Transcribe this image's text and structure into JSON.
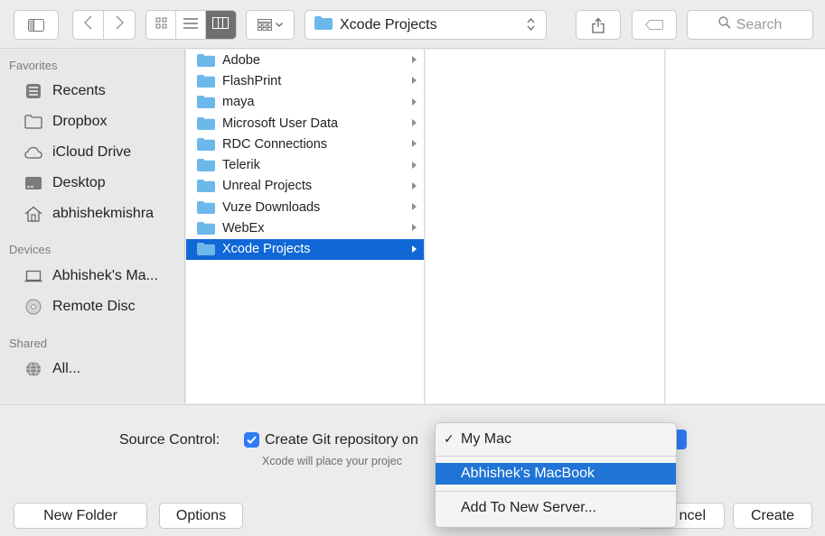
{
  "toolbar": {
    "location": "Xcode Projects",
    "search_placeholder": "Search"
  },
  "sidebar": {
    "favorites_header": "Favorites",
    "favorites": [
      {
        "label": "Recents",
        "icon": "recents-icon"
      },
      {
        "label": "Dropbox",
        "icon": "folder-icon"
      },
      {
        "label": "iCloud Drive",
        "icon": "cloud-icon"
      },
      {
        "label": "Desktop",
        "icon": "desktop-icon"
      },
      {
        "label": "abhishekmishra",
        "icon": "home-icon"
      }
    ],
    "devices_header": "Devices",
    "devices": [
      {
        "label": "Abhishek's Ma...",
        "icon": "laptop-icon"
      },
      {
        "label": "Remote Disc",
        "icon": "disc-icon"
      }
    ],
    "shared_header": "Shared",
    "shared": [
      {
        "label": "All...",
        "icon": "network-globe-icon"
      }
    ]
  },
  "folders": [
    {
      "label": "Adobe"
    },
    {
      "label": "FlashPrint"
    },
    {
      "label": "maya"
    },
    {
      "label": "Microsoft User Data"
    },
    {
      "label": "RDC Connections"
    },
    {
      "label": "Telerik"
    },
    {
      "label": "Unreal Projects"
    },
    {
      "label": "Vuze Downloads"
    },
    {
      "label": "WebEx"
    },
    {
      "label": "Xcode Projects",
      "selected": true
    }
  ],
  "source_control": {
    "label": "Source Control:",
    "checkbox_label": "Create Git repository on",
    "checked": true,
    "hint": "Xcode will place your projec"
  },
  "menu": {
    "items": [
      {
        "label": "My Mac",
        "checked": true
      },
      {
        "label": "Abhishek's MacBook",
        "highlighted": true
      },
      {
        "label": "Add To New Server..."
      }
    ]
  },
  "buttons": {
    "new_folder": "New Folder",
    "options": "Options",
    "cancel": "ncel",
    "create": "Create"
  },
  "colors": {
    "selection": "#1067d6",
    "checkbox": "#2f7cf6",
    "folder": "#6cb8ea"
  }
}
